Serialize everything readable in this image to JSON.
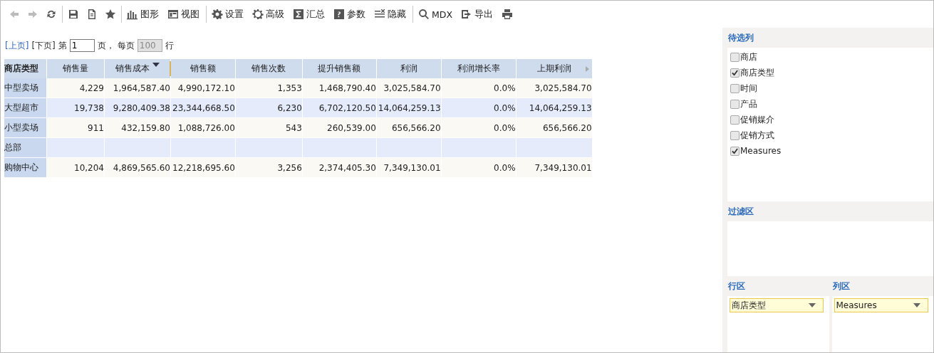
{
  "toolbar": [
    {
      "kind": "back",
      "disabled": true,
      "divider": false
    },
    {
      "kind": "forward",
      "disabled": true,
      "divider": false
    },
    {
      "kind": "refresh",
      "disabled": false,
      "divider": false
    },
    {
      "kind": "save",
      "disabled": false,
      "divider": true
    },
    {
      "kind": "saveas",
      "disabled": false,
      "divider": false
    },
    {
      "kind": "favorite",
      "disabled": false,
      "divider": false
    },
    {
      "kind": "chart",
      "label": "图形",
      "disabled": false,
      "divider": true
    },
    {
      "kind": "view",
      "label": "视图",
      "disabled": false,
      "divider": false
    },
    {
      "kind": "settings",
      "label": "设置",
      "disabled": false,
      "divider": true
    },
    {
      "kind": "advanced",
      "label": "高级",
      "disabled": false,
      "divider": false
    },
    {
      "kind": "summary",
      "label": "汇总",
      "disabled": false,
      "divider": false
    },
    {
      "kind": "params",
      "label": "参数",
      "disabled": false,
      "divider": false
    },
    {
      "kind": "hide",
      "label": "隐藏",
      "disabled": false,
      "divider": false
    },
    {
      "kind": "search",
      "label": "MDX",
      "disabled": false,
      "divider": true
    },
    {
      "kind": "export",
      "label": "导出",
      "disabled": false,
      "divider": false
    },
    {
      "kind": "print",
      "disabled": false,
      "divider": false
    }
  ],
  "pager": {
    "prev": "[上页]",
    "next": "[下页]",
    "page_prefix": "第",
    "page": "1",
    "page_suffix": "页，",
    "per_page_prefix": "每页",
    "per_page": "100",
    "per_page_suffix": "行"
  },
  "table": {
    "columns": [
      {
        "label": "商店类型",
        "sorted": false
      },
      {
        "label": "销售量",
        "sorted": false
      },
      {
        "label": "销售成本",
        "sorted": true
      },
      {
        "label": "销售额",
        "sorted": false
      },
      {
        "label": "销售次数",
        "sorted": false
      },
      {
        "label": "提升销售额",
        "sorted": false
      },
      {
        "label": "利润",
        "sorted": false
      },
      {
        "label": "利润增长率",
        "sorted": false
      },
      {
        "label": "上期利润",
        "sorted": false
      }
    ],
    "rows": [
      [
        "中型卖场",
        "4,229",
        "1,964,587.40",
        "4,990,172.10",
        "1,353",
        "1,468,790.40",
        "3,025,584.70",
        "0.0%",
        "3,025,584.70"
      ],
      [
        "大型超市",
        "19,738",
        "9,280,409.38",
        "23,344,668.50",
        "6,230",
        "6,702,120.50",
        "14,064,259.13",
        "0.0%",
        "14,064,259.13"
      ],
      [
        "小型卖场",
        "911",
        "432,159.80",
        "1,088,726.00",
        "543",
        "260,539.00",
        "656,566.20",
        "0.0%",
        "656,566.20"
      ],
      [
        "总部",
        "",
        "",
        "",
        "",
        "",
        "",
        "",
        ""
      ],
      [
        "购物中心",
        "10,204",
        "4,869,565.60",
        "12,218,695.60",
        "3,256",
        "2,374,405.30",
        "7,349,130.01",
        "0.0%",
        "7,349,130.01"
      ]
    ]
  },
  "panel": {
    "candidates": {
      "title": "待选列",
      "items": [
        {
          "label": "商店",
          "checked": false
        },
        {
          "label": "商店类型",
          "checked": true
        },
        {
          "label": "时间",
          "checked": false
        },
        {
          "label": "产品",
          "checked": false
        },
        {
          "label": "促销媒介",
          "checked": false
        },
        {
          "label": "促销方式",
          "checked": false
        },
        {
          "label": "Measures",
          "checked": true
        }
      ]
    },
    "filter": {
      "title": "过滤区"
    },
    "rows_zone": {
      "title": "行区",
      "fields": [
        "商店类型"
      ]
    },
    "cols_zone": {
      "title": "列区",
      "fields": [
        "Measures"
      ]
    }
  }
}
